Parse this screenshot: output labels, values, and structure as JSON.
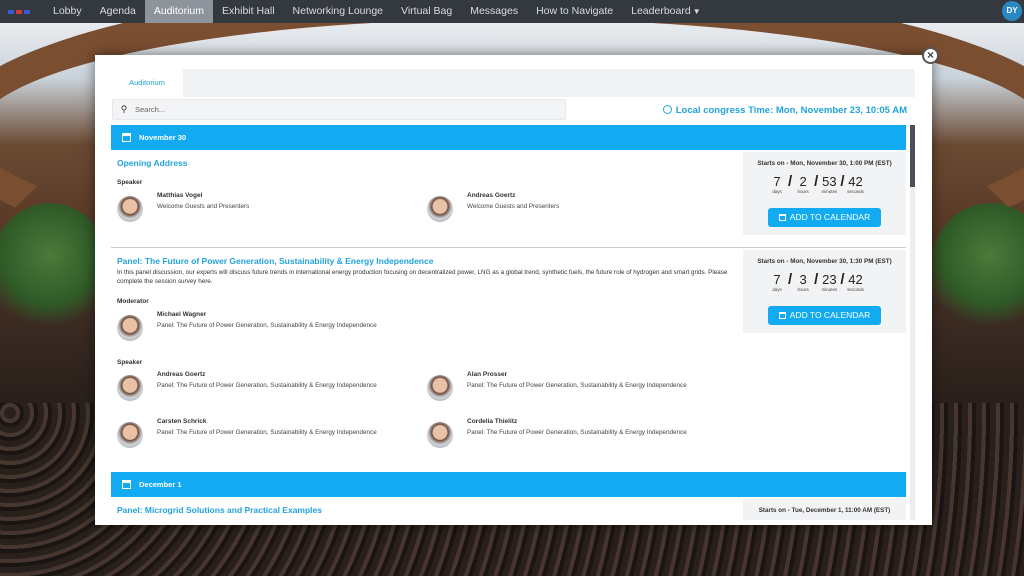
{
  "nav": {
    "items": [
      "Lobby",
      "Agenda",
      "Auditorium",
      "Exhibit Hall",
      "Networking Lounge",
      "Virtual Bag",
      "Messages",
      "How to Navigate",
      "Leaderboard"
    ],
    "active": "Auditorium",
    "avatar_initials": "DY"
  },
  "tab": {
    "label": "Auditorium"
  },
  "search": {
    "placeholder": "Search..."
  },
  "local_time": "Local congress Time: Mon, November 23, 10:05 AM",
  "days": [
    {
      "label": "November 30"
    },
    {
      "label": "December 1"
    }
  ],
  "sessions": [
    {
      "title": "Opening Address",
      "speaker_label": "Speaker",
      "speakers": [
        {
          "name": "Matthias Vogel",
          "topic": "Welcome Guests and Presenters"
        },
        {
          "name": "Andreas Goertz",
          "topic": "Welcome Guests and Presenters"
        }
      ],
      "starts": "Starts on - Mon, November 30, 1:00 PM (EST)",
      "countdown": {
        "days": "7",
        "hours": "2",
        "minutes": "53",
        "seconds": "42"
      },
      "add_to_calendar": "ADD TO CALENDAR"
    },
    {
      "title": "Panel: The Future of Power Generation, Sustainability & Energy Independence",
      "description": "In this panel discussion, our experts will discuss future trends in international energy production focusing on decentralized power, LNG as a global trend, synthetic fuels, the future role of hydrogen and smart grids. Please complete the session survey here.",
      "moderator_label": "Moderator",
      "moderator": {
        "name": "Michael Wagner",
        "topic": "Panel: The Future of Power Generation, Sustainability & Energy Independence"
      },
      "speaker_label": "Speaker",
      "speakers": [
        {
          "name": "Andreas Goertz",
          "topic": "Panel: The Future of Power Generation, Sustainability & Energy Independence"
        },
        {
          "name": "Alan Prosser",
          "topic": "Panel: The Future of Power Generation, Sustainability & Energy Independence"
        },
        {
          "name": "Carsten Schrick",
          "topic": "Panel: The Future of Power Generation, Sustainability & Energy Independence"
        },
        {
          "name": "Cordelia Thielitz",
          "topic": "Panel: The Future of Power Generation, Sustainability & Energy Independence"
        }
      ],
      "starts": "Starts on - Mon, November 30, 1:30 PM (EST)",
      "countdown": {
        "days": "7",
        "hours": "3",
        "minutes": "23",
        "seconds": "42"
      },
      "add_to_calendar": "ADD TO CALENDAR"
    },
    {
      "title": "Panel: Microgrid Solutions and Practical Examples",
      "starts": "Starts on - Tue, December 1, 11:00 AM (EST)"
    }
  ],
  "countdown_labels": {
    "days": "days",
    "hours": "hours",
    "minutes": "minutes",
    "seconds": "seconds"
  },
  "colors": {
    "accent": "#12aaf0",
    "nav_bg": "#34393f",
    "title_blue": "#22a3dc"
  }
}
